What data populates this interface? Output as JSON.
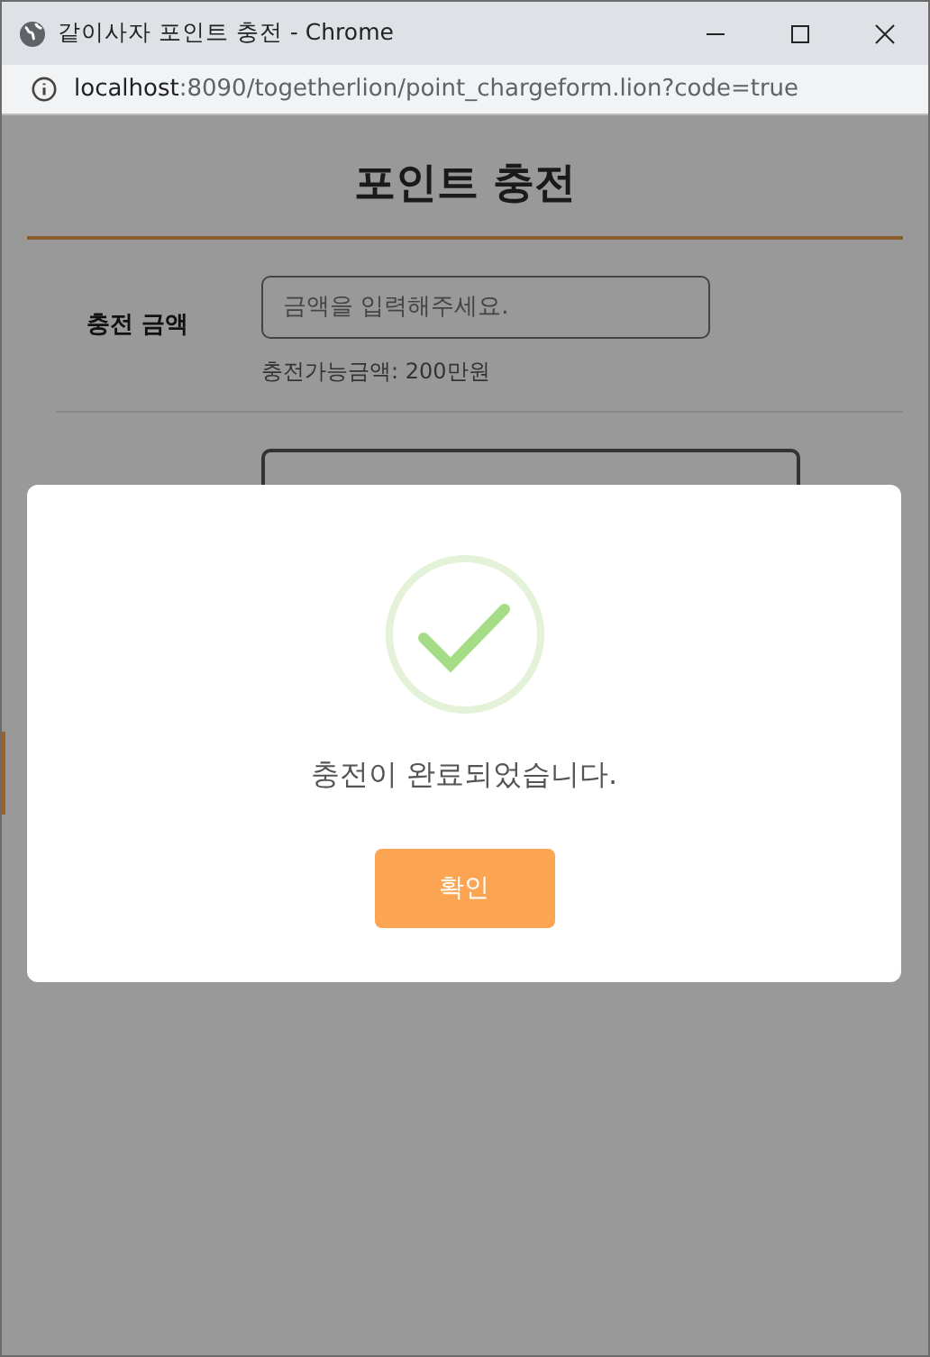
{
  "window": {
    "title": "같이사자 포인트 충전 - Chrome"
  },
  "address_bar": {
    "host": "localhost",
    "path": ":8090/togetherlion/point_chargeform.lion?code=true"
  },
  "page": {
    "title": "포인트 충전",
    "fields": [
      {
        "kind": "amount",
        "label": "충전 금액",
        "placeholder": "금액을 입력해주세요.",
        "hint": "충전가능금액: 200만원"
      },
      {
        "kind": "account"
      }
    ]
  },
  "modal": {
    "message": "충전이 완료되었습니다.",
    "button": "확인"
  }
}
